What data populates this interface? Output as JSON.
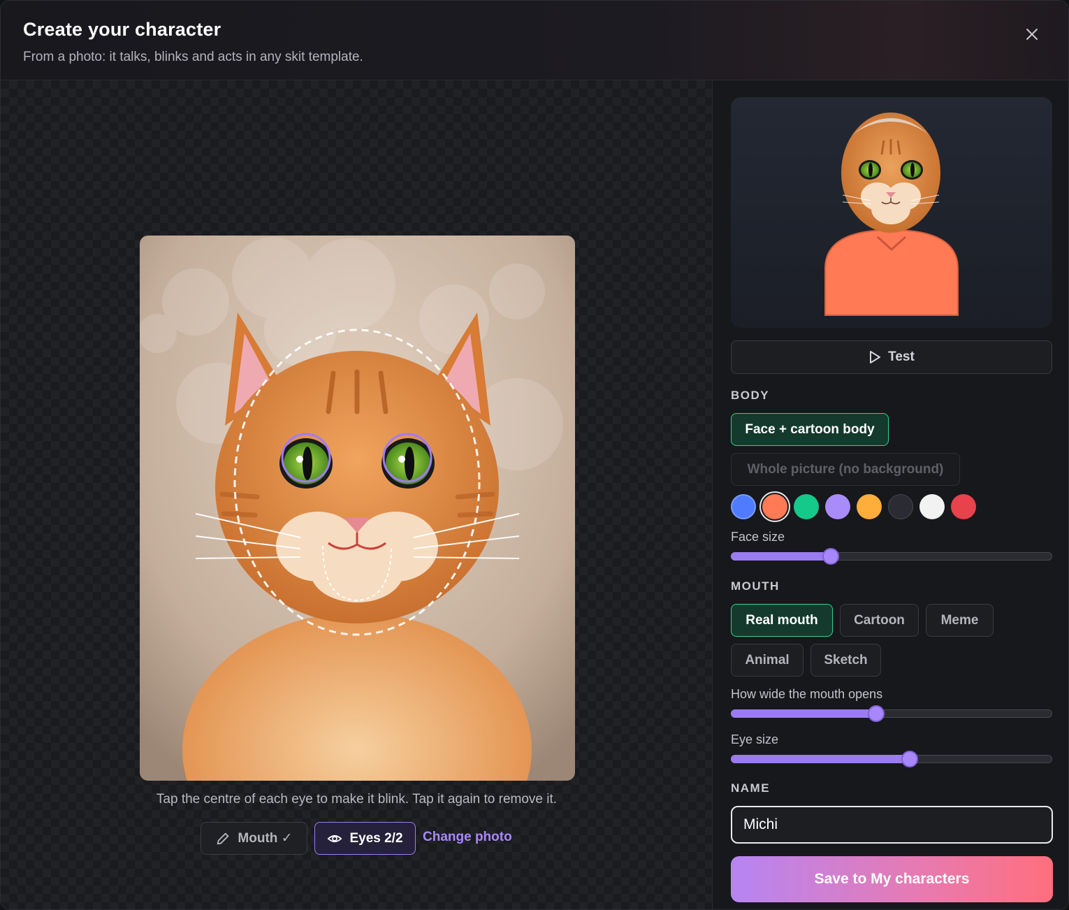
{
  "header": {
    "title": "Create your character",
    "subtitle": "From a photo: it talks, blinks and acts in any skit template."
  },
  "editor": {
    "hint": "Tap the centre of each eye to make it blink. Tap it again to remove it.",
    "mouth_button": "Mouth ✓",
    "eyes_button": "Eyes 2/2",
    "change_photo": "Change photo"
  },
  "panel": {
    "test_label": "Test",
    "body": {
      "label": "BODY",
      "options": [
        "Face + cartoon body",
        "Whole picture (no background)"
      ],
      "selected": "Face + cartoon body",
      "colors": [
        "#4f7cff",
        "#ff7a55",
        "#14c98a",
        "#a98bfa",
        "#ffad3b",
        "#2b2c33",
        "#f2f2f2",
        "#e8424d"
      ],
      "selected_color": "#ff7a55",
      "face_size_label": "Face size",
      "face_size": 0.3
    },
    "mouth": {
      "label": "MOUTH",
      "options": [
        "Real mouth",
        "Cartoon",
        "Meme",
        "Animal",
        "Sketch"
      ],
      "selected": "Real mouth",
      "open_label": "How wide the mouth opens",
      "open_value": 0.45,
      "eye_size_label": "Eye size",
      "eye_size": 0.56
    },
    "name": {
      "label": "NAME",
      "value": "Michi"
    },
    "save_label": "Save to My characters"
  }
}
